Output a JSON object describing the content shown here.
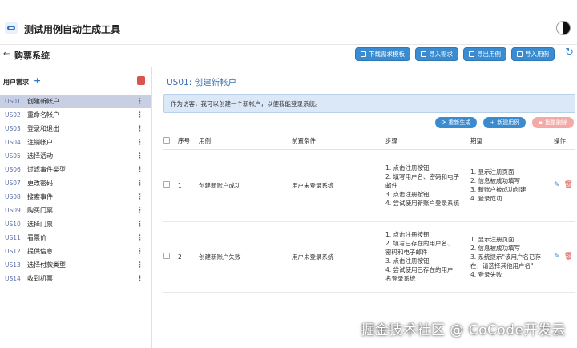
{
  "app": {
    "title": "测试用例自动生成工具"
  },
  "page": {
    "title": "购票系统"
  },
  "header_buttons": [
    {
      "label": "下载需求模板",
      "icon": "download-icon"
    },
    {
      "label": "导入需求",
      "icon": "import-icon"
    },
    {
      "label": "导出用例",
      "icon": "export-icon"
    },
    {
      "label": "导入用例",
      "icon": "import-icon"
    }
  ],
  "sidebar": {
    "heading": "用户需求",
    "add": "+",
    "items": [
      {
        "code": "US01",
        "label": "创建新帐户"
      },
      {
        "code": "US02",
        "label": "重命名帐户"
      },
      {
        "code": "US03",
        "label": "登录和退出"
      },
      {
        "code": "US04",
        "label": "注销帐户"
      },
      {
        "code": "US05",
        "label": "选择活动"
      },
      {
        "code": "US06",
        "label": "过滤事件类型"
      },
      {
        "code": "US07",
        "label": "更改密码"
      },
      {
        "code": "US08",
        "label": "搜索事件"
      },
      {
        "code": "US09",
        "label": "购买门票"
      },
      {
        "code": "US10",
        "label": "选择门票"
      },
      {
        "code": "US11",
        "label": "看票价"
      },
      {
        "code": "US12",
        "label": "提供信息"
      },
      {
        "code": "US13",
        "label": "选择付款类型"
      },
      {
        "code": "US14",
        "label": "收到机票"
      }
    ],
    "more": "⋮"
  },
  "story": {
    "title": "US01:  创建新帐户",
    "description": "作为访客，我可以创建一个新帐户，以便我能登录系统。"
  },
  "actions": {
    "regenerate": "重新生成",
    "new_case": "新建用例",
    "batch_delete": "批量删除"
  },
  "table": {
    "headers": {
      "seq": "序号",
      "case": "用例",
      "precondition": "前置条件",
      "steps": "步骤",
      "expected": "期望",
      "ops": "操作"
    },
    "rows": [
      {
        "seq": "1",
        "case": "创建新账户成功",
        "precondition": "用户未登录系统",
        "steps": [
          "1. 点击注册按钮",
          "2. 填写用户名、密码和电子",
          "邮件",
          "3. 点击注册按钮",
          "4. 尝试使用新账户登录系统"
        ],
        "expected": [
          "1. 显示注册页面",
          "2. 信息被成功填写",
          "3. 新账户被成功创建",
          "4. 登录成功"
        ]
      },
      {
        "seq": "2",
        "case": "创建新账户失败",
        "precondition": "用户未登录系统",
        "steps": [
          "1. 点击注册按钮",
          "2. 填写已存在的用户名、",
          "密码和电子邮件",
          "3. 点击注册按钮",
          "4. 尝试使用已存在的用户",
          "名登录系统"
        ],
        "expected": [
          "1. 显示注册页面",
          "2. 信息被成功填写",
          "3. 系统提示\"该用户名已存",
          "在，请选择其他用户名\"",
          "4. 登录失败"
        ]
      }
    ]
  },
  "watermark": "掘金技术社区 @ CoCode开发云",
  "colors": {
    "primary": "#3b8bd0",
    "danger": "#d9534f",
    "active_row": "#c9cfe3",
    "info_bg": "#dbe8f7"
  }
}
